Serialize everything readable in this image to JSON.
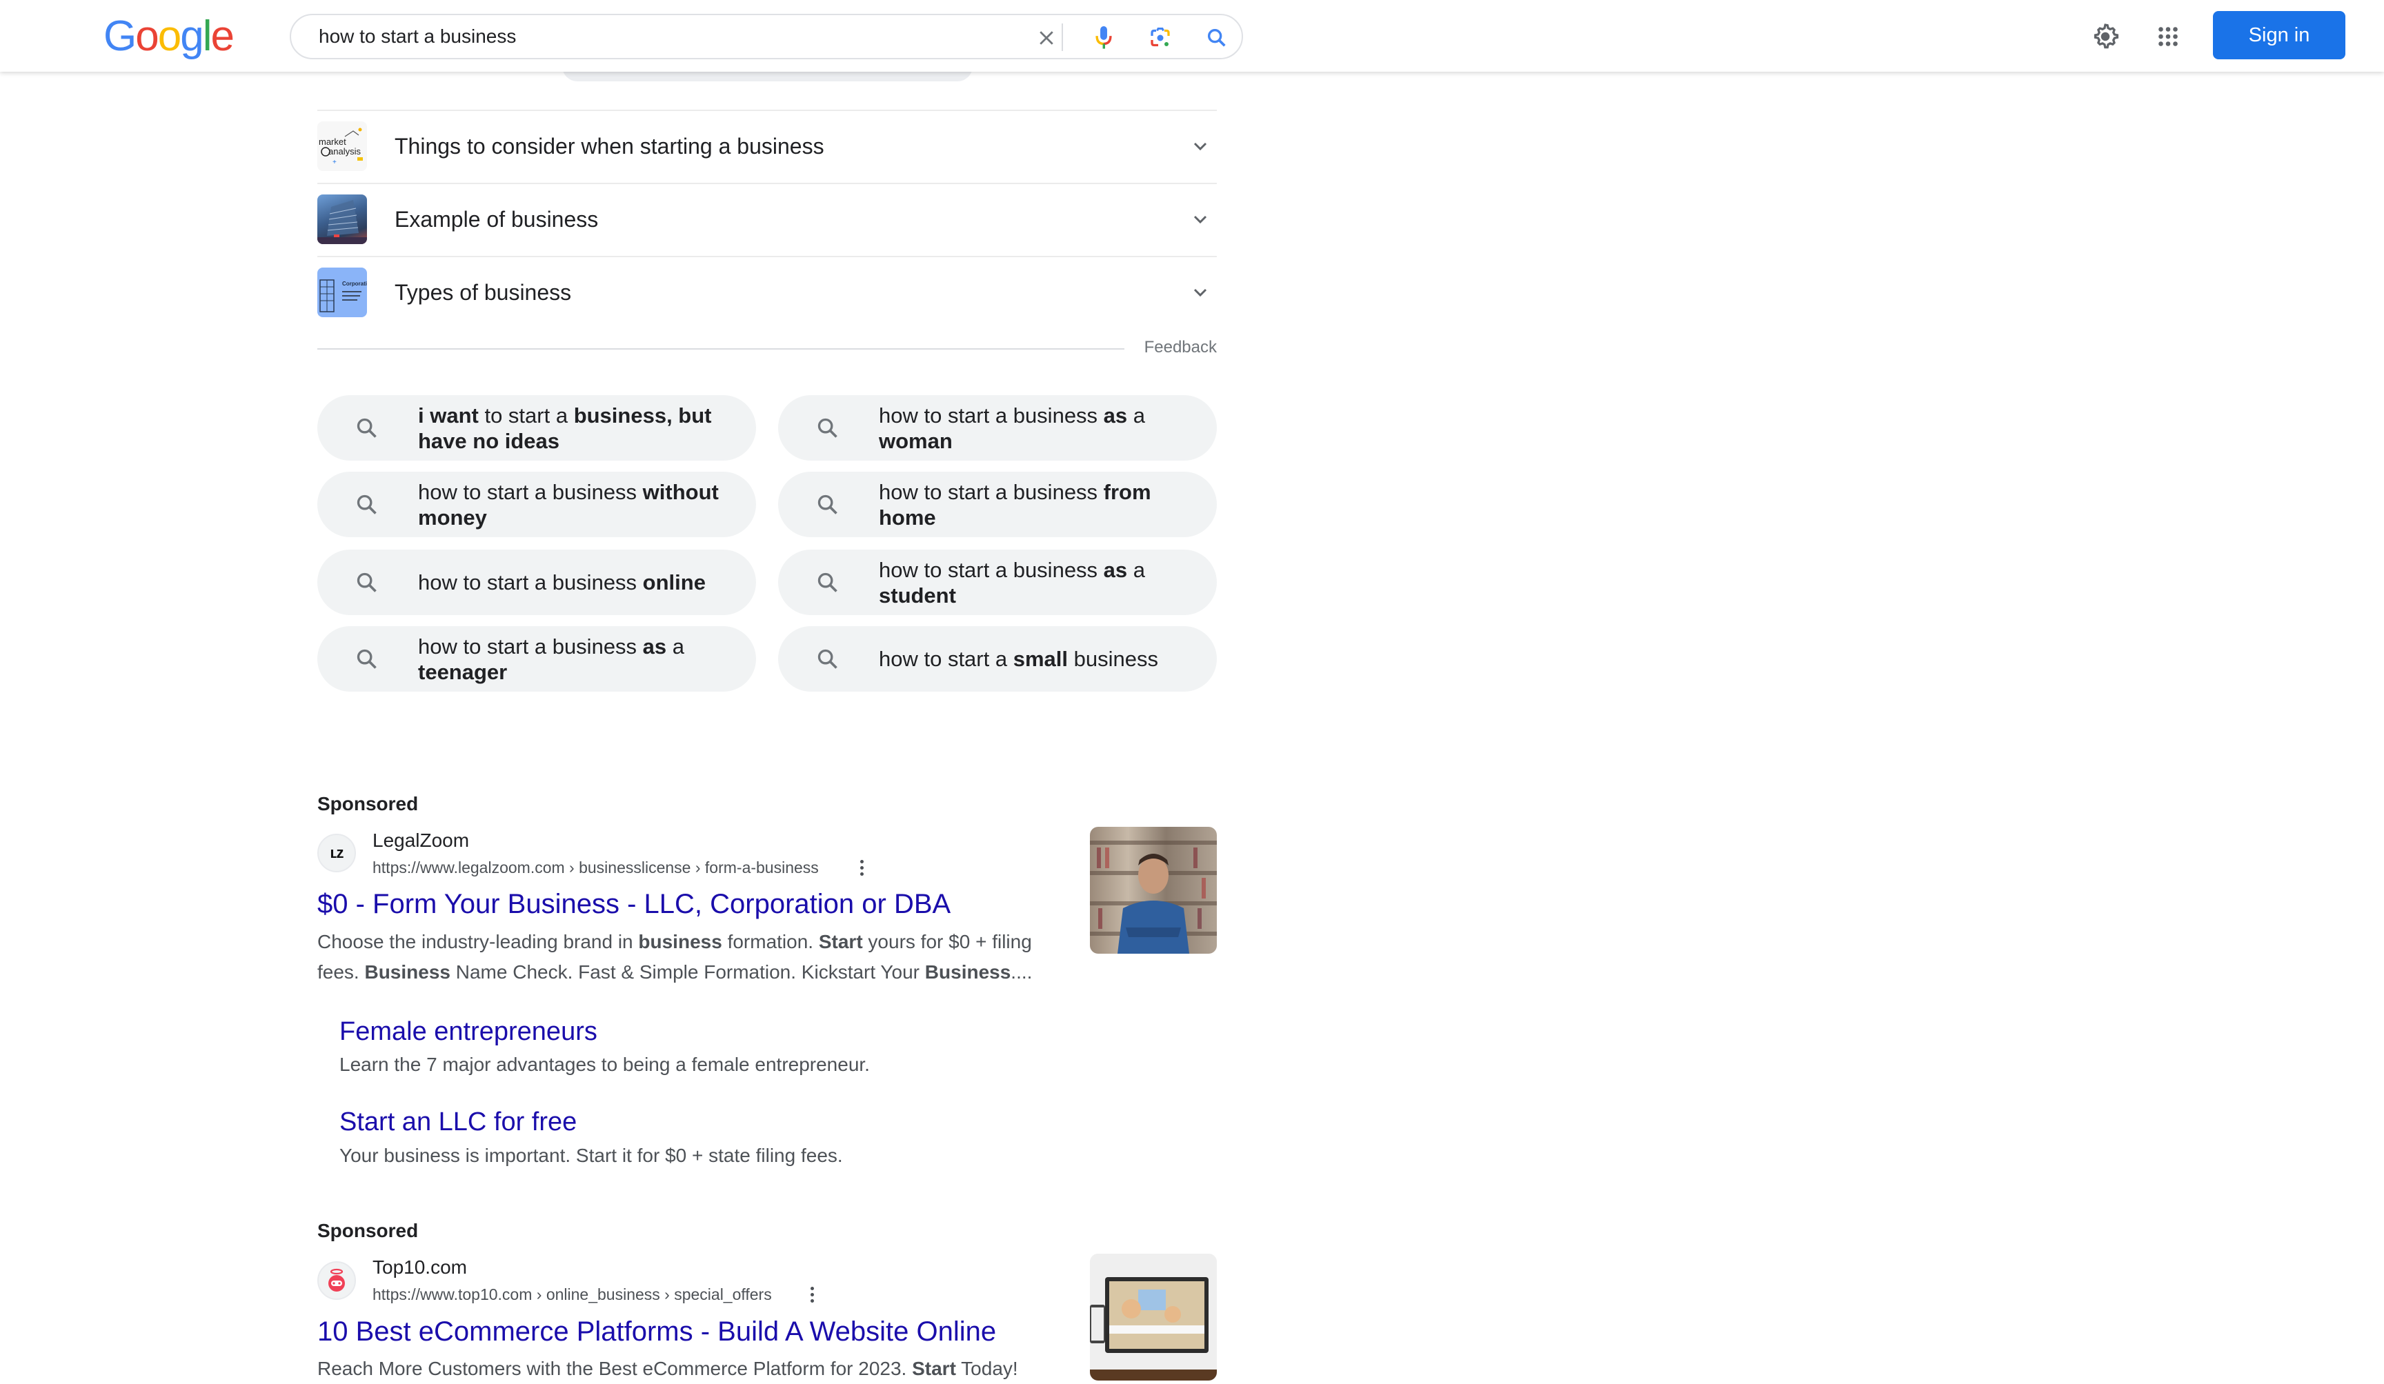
{
  "header": {
    "logo_letters": [
      {
        "char": "G",
        "color": "#4285f4"
      },
      {
        "char": "o",
        "color": "#ea4335"
      },
      {
        "char": "o",
        "color": "#fbbc05"
      },
      {
        "char": "g",
        "color": "#4285f4"
      },
      {
        "char": "l",
        "color": "#34a853"
      },
      {
        "char": "e",
        "color": "#ea4335"
      }
    ],
    "search_query": "how to start a business",
    "icons": {
      "clear": "close-icon",
      "voice": "microphone-icon",
      "lens": "google-lens-icon",
      "search": "search-icon",
      "settings": "gear-icon",
      "apps": "apps-grid-icon"
    },
    "signin_label": "Sign in",
    "accent_color": "#1a73e8"
  },
  "accordion": {
    "items": [
      {
        "label": "Things to consider when starting a business",
        "thumb": "market analysis"
      },
      {
        "label": "Example of business",
        "thumb": "office building"
      },
      {
        "label": "Types of business",
        "thumb": "Corporation"
      }
    ],
    "feedback_label": "Feedback"
  },
  "related_searches": [
    {
      "parts": [
        {
          "t": "i want",
          "b": true
        },
        {
          "t": " to start a ",
          "b": false
        },
        {
          "t": "business, but have no ideas",
          "b": true
        }
      ]
    },
    {
      "parts": [
        {
          "t": "how to start a business ",
          "b": false
        },
        {
          "t": "as",
          "b": true
        },
        {
          "t": " a ",
          "b": false
        },
        {
          "t": "woman",
          "b": true
        }
      ]
    },
    {
      "parts": [
        {
          "t": "how to start a business ",
          "b": false
        },
        {
          "t": "without money",
          "b": true
        }
      ]
    },
    {
      "parts": [
        {
          "t": "how to start a business ",
          "b": false
        },
        {
          "t": "from home",
          "b": true
        }
      ]
    },
    {
      "parts": [
        {
          "t": "how to start a business ",
          "b": false
        },
        {
          "t": "online",
          "b": true
        }
      ]
    },
    {
      "parts": [
        {
          "t": "how to start a business ",
          "b": false
        },
        {
          "t": "as",
          "b": true
        },
        {
          "t": " a ",
          "b": false
        },
        {
          "t": "student",
          "b": true
        }
      ]
    },
    {
      "parts": [
        {
          "t": "how to start a business ",
          "b": false
        },
        {
          "t": "as",
          "b": true
        },
        {
          "t": " a ",
          "b": false
        },
        {
          "t": "teenager",
          "b": true
        }
      ]
    },
    {
      "parts": [
        {
          "t": "how to start a ",
          "b": false
        },
        {
          "t": "small",
          "b": true
        },
        {
          "t": " business",
          "b": false
        }
      ]
    }
  ],
  "ads": [
    {
      "sponsored_label": "Sponsored",
      "favicon_text": "LZ",
      "site_name": "LegalZoom",
      "url": "https://www.legalzoom.com › businesslicense › form-a-business",
      "title": "$0 - Form Your Business - LLC, Corporation or DBA",
      "desc_parts": [
        {
          "t": "Choose the industry-leading brand in ",
          "b": false
        },
        {
          "t": "business",
          "b": true
        },
        {
          "t": " formation. ",
          "b": false
        },
        {
          "t": "Start",
          "b": true
        },
        {
          "t": " yours for $0 + filing fees. ",
          "b": false
        },
        {
          "t": "Business",
          "b": true
        },
        {
          "t": " Name Check. Fast & Simple Formation. Kickstart Your ",
          "b": false
        },
        {
          "t": "Business",
          "b": true
        },
        {
          "t": "....",
          "b": false
        }
      ],
      "sitelinks": [
        {
          "title": "Female entrepreneurs",
          "desc": "Learn the 7 major advantages to being a female entrepreneur."
        },
        {
          "title": "Start an LLC for free",
          "desc": "Your business is important. Start it for $0 + state filing fees."
        }
      ]
    },
    {
      "sponsored_label": "Sponsored",
      "favicon_text": "",
      "site_name": "Top10.com",
      "url": "https://www.top10.com › online_business › special_offers",
      "title": "10 Best eCommerce Platforms - Build A Website Online",
      "desc_parts": [
        {
          "t": "Reach More Customers with the Best eCommerce Platform for 2023. ",
          "b": false
        },
        {
          "t": "Start",
          "b": true
        },
        {
          "t": " Today!",
          "b": false
        }
      ]
    }
  ],
  "colors": {
    "link": "#1a0dab",
    "chip_bg": "#f1f3f4",
    "muted_text": "#4d5156"
  }
}
